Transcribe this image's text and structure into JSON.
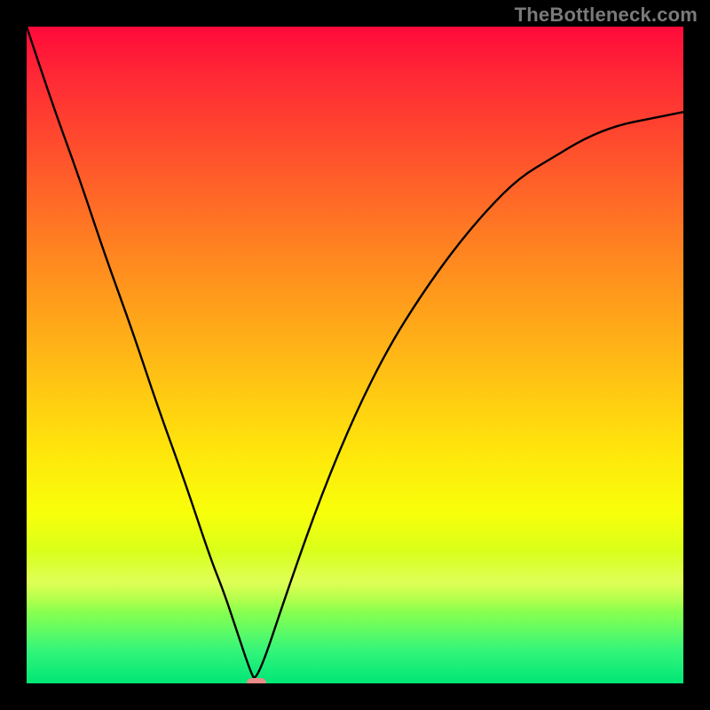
{
  "watermark": "TheBottleneck.com",
  "chart_data": {
    "type": "line",
    "title": "",
    "xlabel": "",
    "ylabel": "",
    "xlim": [
      0,
      100
    ],
    "ylim": [
      0,
      100
    ],
    "grid": false,
    "legend": false,
    "series": [
      {
        "name": "bottleneck-curve",
        "x": [
          0,
          4,
          8,
          12,
          16,
          20,
          24,
          28,
          30,
          32,
          34,
          35,
          40,
          45,
          50,
          55,
          60,
          65,
          70,
          75,
          80,
          85,
          90,
          95,
          100
        ],
        "y": [
          100,
          88,
          77,
          65,
          54,
          42,
          31,
          19,
          14,
          8,
          2,
          0,
          15,
          29,
          41,
          51,
          59,
          66,
          72,
          77,
          80,
          83,
          85,
          86,
          87
        ]
      }
    ],
    "marker": {
      "x": 35,
      "y": 0,
      "color": "#e98b88"
    },
    "gradient_stops": [
      {
        "pos": 0,
        "color": "#ff0a3a"
      },
      {
        "pos": 0.5,
        "color": "#ffe40c"
      },
      {
        "pos": 1,
        "color": "#00e676"
      }
    ]
  }
}
